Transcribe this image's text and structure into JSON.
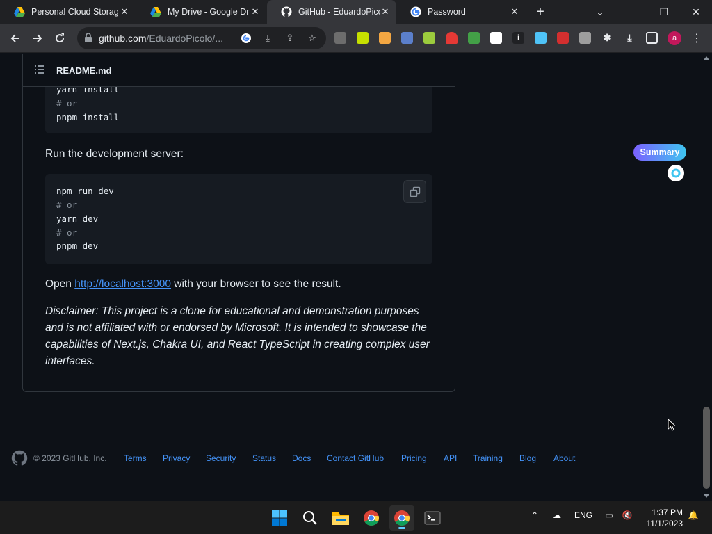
{
  "browser": {
    "tabs": [
      {
        "title": "Personal Cloud Storag",
        "icon": "google-drive-icon"
      },
      {
        "title": "My Drive - Google Dri",
        "icon": "google-drive-icon"
      },
      {
        "title": "GitHub - EduardoPicol",
        "icon": "github-icon",
        "active": true
      },
      {
        "title": "Password",
        "icon": "google-icon"
      }
    ],
    "new_tab_label": "+",
    "address": {
      "host": "github.com",
      "path": "/EduardoPicolo/..."
    },
    "profile_initial": "a",
    "window_controls": {
      "minimize": "—",
      "restore": "❐",
      "close": "✕",
      "tab_search": "⌄"
    }
  },
  "readme": {
    "filename": "README.md",
    "install_block": {
      "lines": [
        {
          "text": "yarn install",
          "comment": false
        },
        {
          "text": "# or",
          "comment": true
        },
        {
          "text": "pnpm install",
          "comment": false
        }
      ]
    },
    "run_label": "Run the development server:",
    "dev_block": {
      "lines": [
        {
          "text": "npm run dev",
          "comment": false
        },
        {
          "text": "# or",
          "comment": true
        },
        {
          "text": "yarn dev",
          "comment": false
        },
        {
          "text": "# or",
          "comment": true
        },
        {
          "text": "pnpm dev",
          "comment": false
        }
      ]
    },
    "open_prefix": "Open ",
    "open_link": "http://localhost:3000",
    "open_suffix": " with your browser to see the result.",
    "disclaimer": "Disclaimer: This project is a clone for educational and demonstration purposes and is not affiliated with or endorsed by Microsoft. It is intended to showcase the capabilities of Next.js, Chakra UI, and React TypeScript in creating complex user interfaces."
  },
  "summary_widget": {
    "label": "Summary"
  },
  "footer": {
    "copyright": "© 2023 GitHub, Inc.",
    "links": [
      "Terms",
      "Privacy",
      "Security",
      "Status",
      "Docs",
      "Contact GitHub",
      "Pricing",
      "API",
      "Training",
      "Blog",
      "About"
    ]
  },
  "taskbar": {
    "language": "ENG",
    "time": "1:37 PM",
    "date": "11/1/2023"
  },
  "colors": {
    "page_bg": "#0d1117",
    "link": "#4493f8",
    "code_bg": "#161b22",
    "border": "#30363d"
  }
}
